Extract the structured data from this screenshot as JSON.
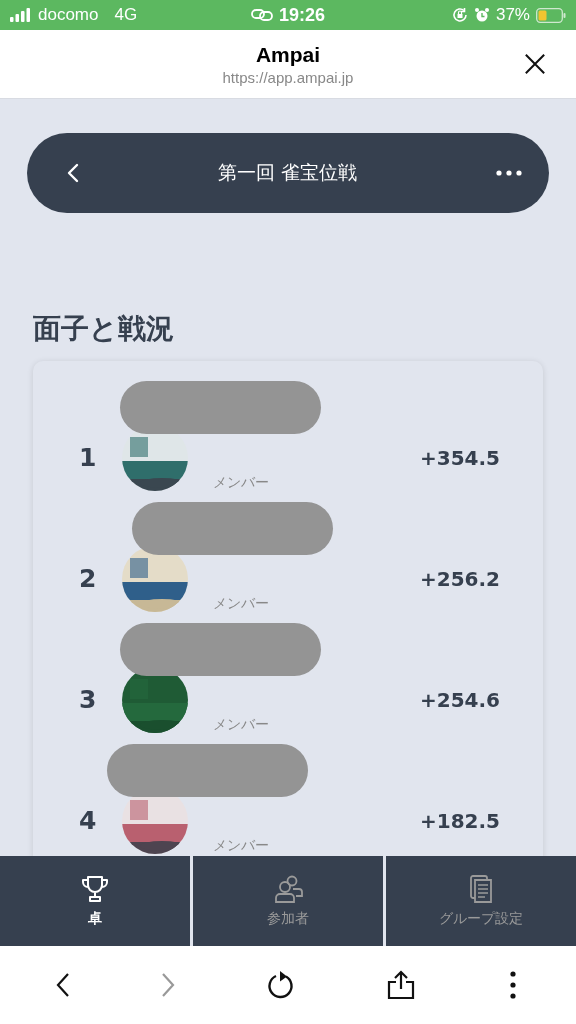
{
  "status_bar": {
    "carrier": "docomo",
    "network": "4G",
    "time": "19:26",
    "battery": "37%"
  },
  "browser": {
    "title": "Ampai",
    "url": "https://app.ampai.jp"
  },
  "header": {
    "title": "第一回 雀宝位戦"
  },
  "section_title": "面子と戦況",
  "ranking": [
    {
      "rank": "1",
      "role": "メンバー",
      "score": "+354.5"
    },
    {
      "rank": "2",
      "role": "メンバー",
      "score": "+256.2"
    },
    {
      "rank": "3",
      "role": "メンバー",
      "score": "+254.6"
    },
    {
      "rank": "4",
      "role": "メンバー",
      "score": "+182.5"
    }
  ],
  "tabs": [
    {
      "label": "卓",
      "kind": "trophy",
      "selected": true
    },
    {
      "label": "参加者",
      "kind": "people",
      "selected": false
    },
    {
      "label": "グループ設定",
      "kind": "documents",
      "selected": false
    }
  ],
  "toolbar": [
    {
      "kind": "back",
      "disabled": false
    },
    {
      "kind": "forward",
      "disabled": true
    },
    {
      "kind": "reload",
      "disabled": false
    },
    {
      "kind": "share",
      "disabled": false
    },
    {
      "kind": "more",
      "disabled": false
    }
  ]
}
